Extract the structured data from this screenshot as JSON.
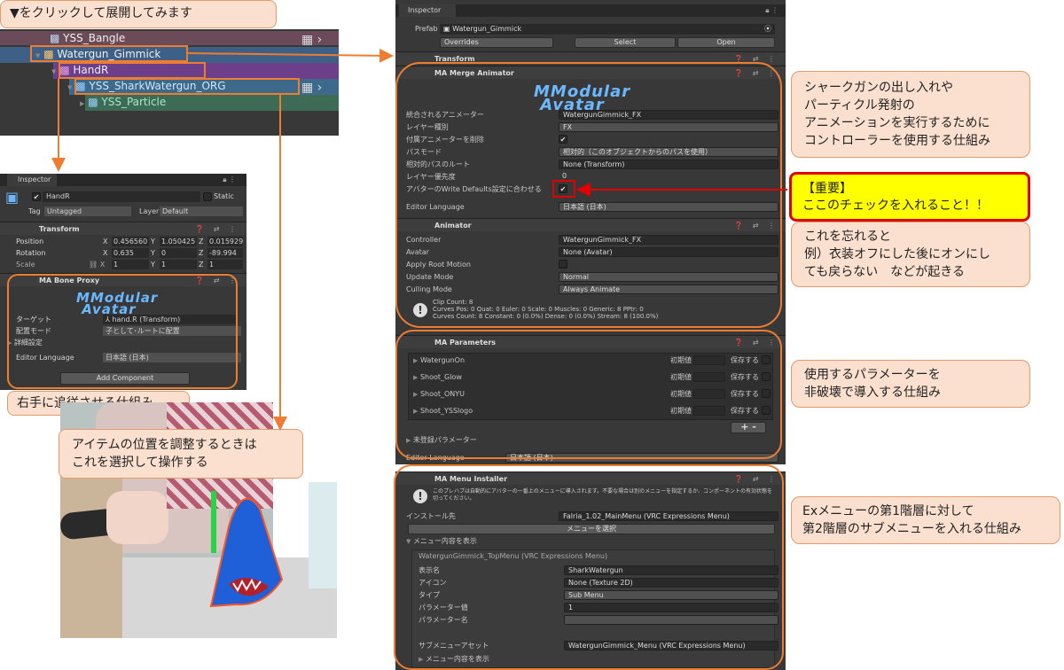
{
  "notes": {
    "expand": "▼をクリックして展開してみます",
    "shark": "シャークガンの出し入れや\nパーティクル発射の\nアニメーションを実行するために\nコントローラーを使用する仕組み",
    "important": "【重要】\nここのチェックを入れること！！",
    "forget": "これを忘れると\n例）衣装オフにした後にオンにし\nても戻らない　などが起きる",
    "params": "使用するパラメーターを\n非破壊で導入する仕組み",
    "menu": "Exメニューの第1階層に対して\n第2階層のサブメニューを入れる仕組み",
    "righthand": "右手に追従させる仕組み",
    "item": "アイテムの位置を調整するときは\nこれを選択して操作する"
  },
  "hierarchy": [
    "YSS_Bangle",
    "Watergun_Gimmick",
    "HandR",
    "YSS_SharkWatergun_ORG",
    "YSS_Particle"
  ],
  "small_inspector": {
    "tab": "Inspector",
    "name": "HandR",
    "static": "Static",
    "tag_label": "Tag",
    "tag": "Untagged",
    "layer_label": "Layer",
    "layer": "Default",
    "transform": "Transform",
    "position": {
      "label": "Position",
      "x": "0.456560",
      "y": "1.050425",
      "z": "0.015929"
    },
    "rotation": {
      "label": "Rotation",
      "x": "0.635",
      "y": "0",
      "z": "-89.994"
    },
    "scale": {
      "label": "Scale",
      "x": "1",
      "y": "1",
      "z": "1"
    },
    "bone_proxy": "MA Bone Proxy",
    "target_label": "ターゲット",
    "target": "hand.R (Transform)",
    "mode_label": "配置モード",
    "mode": "子として･ルートに配置",
    "details": "詳細設定",
    "lang_label": "Editor Language",
    "lang": "日本語 (日本)",
    "add_component": "Add Component"
  },
  "inspector": {
    "tab": "Inspector",
    "prefab_label": "Prefab",
    "prefab": "Watergun_Gimmick",
    "overrides": "Overrides",
    "select": "Select",
    "open": "Open",
    "transform": "Transform",
    "merge_animator": "MA Merge Animator",
    "logo1": "Modular",
    "logo2": "Avatar",
    "merge_rows": [
      {
        "label": "統合されるアニメーター",
        "value": "WatergunGimmick_FX"
      },
      {
        "label": "レイヤー種別",
        "value": "FX"
      },
      {
        "label": "付属アニメーターを削除",
        "value": "✔"
      },
      {
        "label": "パスモード",
        "value": "相対的（このオブジェクトからのパスを使用）"
      },
      {
        "label": "相対的パスのルート",
        "value": "None (Transform)"
      },
      {
        "label": "レイヤー優先度",
        "value": "0"
      },
      {
        "label": "アバターのWrite Defaults設定に合わせる",
        "value": "✔"
      },
      {
        "label": "Editor Language",
        "value": "日本語 (日本)"
      }
    ],
    "animator": "Animator",
    "animator_rows": [
      {
        "label": "Controller",
        "value": "WatergunGimmick_FX"
      },
      {
        "label": "Avatar",
        "value": "None (Avatar)"
      },
      {
        "label": "Apply Root Motion",
        "value": ""
      },
      {
        "label": "Update Mode",
        "value": "Normal"
      },
      {
        "label": "Culling Mode",
        "value": "Always Animate"
      }
    ],
    "clip_info": [
      "Clip Count: 8",
      "Curves Pos: 0 Quat: 0 Euler: 0 Scale: 0 Muscles: 0 Generic: 8 PPtr: 0",
      "Curves Count: 8 Constant: 0 (0.0%) Dense: 0 (0.0%) Stream: 8 (100.0%)"
    ],
    "parameters": "MA Parameters",
    "param_rows": [
      "WatergunOn",
      "Shoot_Glow",
      "Shoot_ONYU",
      "Shoot_YSSlogo"
    ],
    "initial": "初期値",
    "save": "保存する",
    "unregistered": "未登録パラメーター",
    "param_lang_label": "Editor Language",
    "param_lang": "日本語 (日本)",
    "menu_installer": "MA Menu Installer",
    "menu_desc": "このプレハブは自動的にアバターの一番上のメニューに導入されます。不要な場合は別のメニューを指定するか、コンポーネントの有効状態を切ってください。",
    "install_label": "インストール先",
    "install": "Falria_1.02_MainMenu (VRC Expressions Menu)",
    "select_menu": "メニューを選択",
    "show_menu": "メニュー内容を表示",
    "topmenu": "WatergunGimmick_TopMenu (VRC Expressions Menu)",
    "menu_rows": [
      {
        "label": "表示名",
        "value": "SharkWatergun"
      },
      {
        "label": "アイコン",
        "value": "None (Texture 2D)"
      },
      {
        "label": "タイプ",
        "value": "Sub Menu"
      },
      {
        "label": "パラメーター値",
        "value": "1"
      },
      {
        "label": "パラメーター名",
        "value": ""
      }
    ],
    "submenu_label": "サブメニューアセット",
    "submenu": "WatergunGimmick_Menu (VRC Expressions Menu)",
    "show_menu2": "メニュー内容を表示"
  }
}
